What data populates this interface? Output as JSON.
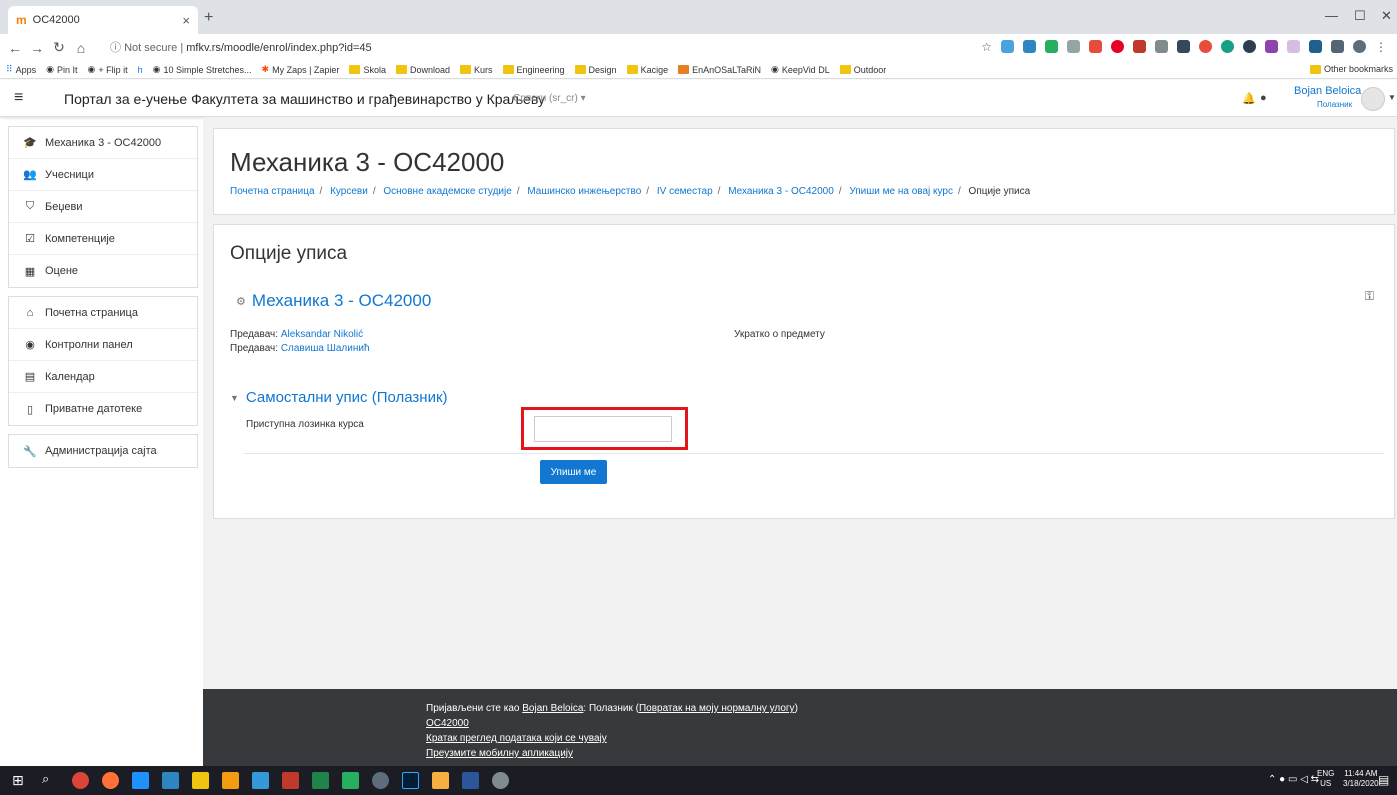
{
  "browser": {
    "tab_title": "OC42000",
    "tab_favicon": "m",
    "new_tab": "+",
    "close_tab": "×",
    "security_label": "Not secure",
    "url": "mfkv.rs/moodle/enrol/index.php?id=45",
    "bookmarks": [
      "Apps",
      "Pin It",
      "+ Flip it",
      "10 Simple Stretches...",
      "My Zaps | Zapier",
      "Skola",
      "Download",
      "Kurs",
      "Engineering",
      "Design",
      "Kacige",
      "EnAnOSaLTaRiN",
      "KeepVid DL",
      "Outdoor"
    ],
    "other_bookmarks": "Other bookmarks"
  },
  "navbar": {
    "site_title": "Портал за е-учење Факултета за машинство и грађевинарство у Краљеву",
    "language": "Српски (sr_cr) ▾",
    "user_name": "Bojan Beloica",
    "user_role": "Полазник"
  },
  "sidebar": {
    "group1": [
      {
        "label": "Механика 3 - OC42000",
        "icon": "graduation-cap-icon",
        "glyph": "🎓"
      },
      {
        "label": "Учесници",
        "icon": "users-icon",
        "glyph": "👥"
      },
      {
        "label": "Беџеви",
        "icon": "shield-icon",
        "glyph": "⛉"
      },
      {
        "label": "Компетенције",
        "icon": "check-square-icon",
        "glyph": "☑"
      },
      {
        "label": "Оцене",
        "icon": "table-icon",
        "glyph": "▦"
      }
    ],
    "group2": [
      {
        "label": "Почетна страница",
        "icon": "home-icon",
        "glyph": "⌂"
      },
      {
        "label": "Контролни панел",
        "icon": "dashboard-icon",
        "glyph": "◉"
      },
      {
        "label": "Календар",
        "icon": "calendar-icon",
        "glyph": "▤"
      },
      {
        "label": "Приватне датотеке",
        "icon": "file-icon",
        "glyph": "▯"
      }
    ],
    "group3": [
      {
        "label": "Администрација сајта",
        "icon": "wrench-icon",
        "glyph": "🔧"
      }
    ]
  },
  "header": {
    "course_title": "Механика 3 - OC42000",
    "breadcrumb": [
      "Почетна страница",
      "Курсеви",
      "Основне академске студије",
      "Машинско инжењерство",
      "IV семестар",
      "Механика 3 - OC42000",
      "Упиши ме на овај курс"
    ],
    "breadcrumb_current": "Опције уписа"
  },
  "main": {
    "page_title": "Опције уписа",
    "course_name": "Механика 3 - OC42000",
    "teachers": [
      {
        "role": "Предавач:",
        "name": "Aleksandar Nikolić"
      },
      {
        "role": "Предавач:",
        "name": "Славиша Шалинић"
      }
    ],
    "summary_label": "Укратко о предмету",
    "section_title": "Самостални упис (Полазник)",
    "password_label": "Приступна лозинка курса",
    "password_value": "",
    "enrol_button": "Упиши ме"
  },
  "footer": {
    "logged_in_prefix": "Пријављени сте као ",
    "user_link": "Bojan Beloica",
    "role_text": ": Полазник (",
    "return_link": "Повратак на моју нормалну улогу",
    "close_paren": ")",
    "course_link": "OC42000",
    "data_link": "Кратак преглед података који се чувају",
    "app_link": "Преузмите мобилну апликацију"
  },
  "taskbar": {
    "lang_top": "ENG",
    "lang_bottom": "US",
    "time": "11:44 AM",
    "date": "3/18/2020"
  },
  "colors": {
    "link": "#1177d1",
    "highlight_frame": "#e0161b",
    "footer_bg": "#373a3c"
  }
}
